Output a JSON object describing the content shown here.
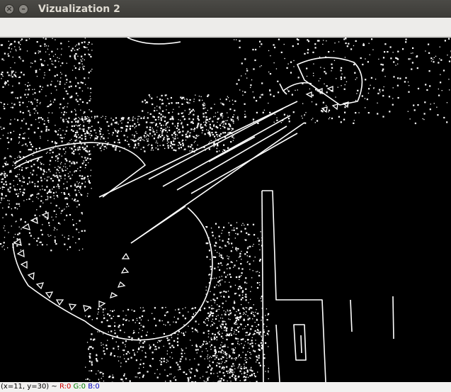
{
  "window": {
    "title": "Vizualization 2",
    "close_glyph": "×",
    "minimize_glyph": "–"
  },
  "status": {
    "coords": "(x=11, y=30) ~ ",
    "r": "R:0",
    "g": "G:0",
    "b": "B:0"
  },
  "image": {
    "description_icon": "edge-detected-guitar-image",
    "background_color": "#000000",
    "edge_color": "#ffffff"
  }
}
